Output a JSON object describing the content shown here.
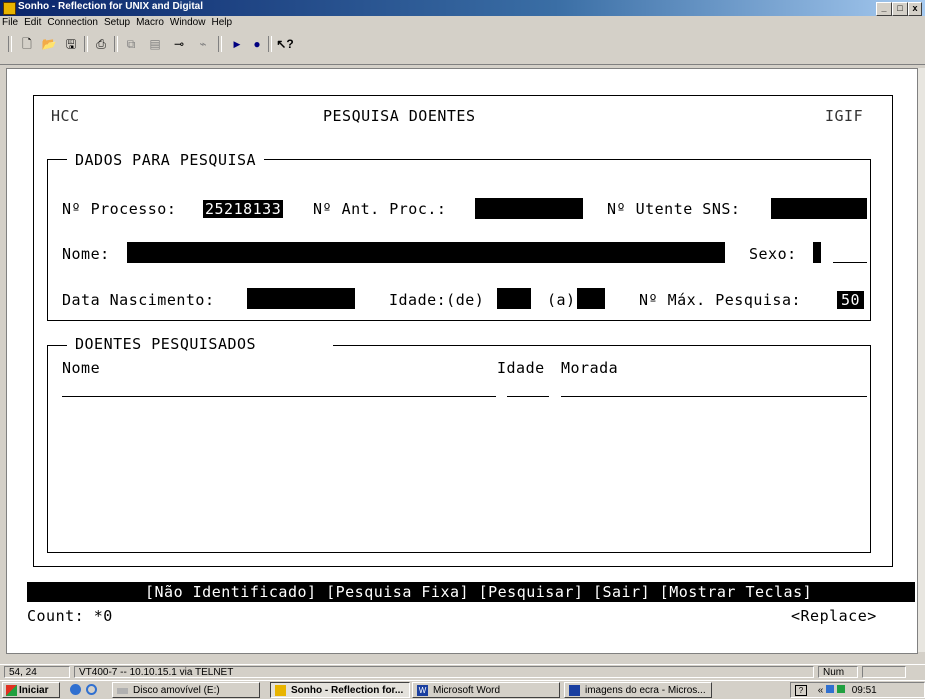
{
  "window": {
    "title": "Sonho - Reflection for UNIX and Digital",
    "controls": [
      "_",
      "□",
      "x"
    ]
  },
  "menu": [
    "File",
    "Edit",
    "Connection",
    "Setup",
    "Macro",
    "Window",
    "Help"
  ],
  "toolbar": {
    "icons": [
      "new-icon",
      "open-icon",
      "save-icon",
      "print-icon",
      "copy-icon",
      "paste-icon",
      "connect-icon",
      "disconnect-icon",
      "play-icon",
      "record-icon",
      "help-pointer-icon"
    ]
  },
  "screen": {
    "header_left": "HCC",
    "header_title": "PESQUISA DOENTES",
    "header_right": "IGIF",
    "search_section_title": "DADOS PARA PESQUISA",
    "processo_label": "Nº Processo:",
    "processo_value": "25218133",
    "ant_proc_label": "Nº Ant. Proc.:",
    "utente_label": "Nº Utente SNS:",
    "nome_label": "Nome:",
    "sexo_label": "Sexo:",
    "data_nasc_label": "Data Nascimento:",
    "idade_de_label": "Idade:(de)",
    "idade_a_label": "(a)",
    "max_pesquisa_label": "Nº Máx. Pesquisa:",
    "max_pesquisa_value": "50",
    "results_section_title": "DOENTES PESQUISADOS",
    "col_nome": "Nome",
    "col_idade": "Idade",
    "col_morada": "Morada",
    "function_keys": "[Não Identificado] [Pesquisa Fixa] [Pesquisar] [Sair] [Mostrar Teclas]",
    "count_text": "Count: *0",
    "mode_text": "<Replace>"
  },
  "statusbar": {
    "cursor": "54, 24",
    "connection": "VT400-7 -- 10.10.15.1 via TELNET",
    "num": "Num"
  },
  "taskbar": {
    "start": "Iniciar",
    "tasks": [
      "Disco amovível (E:)",
      "Sonho - Reflection for...",
      "Microsoft Word",
      "imagens do ecra - Micros..."
    ],
    "clock": "09:51"
  }
}
